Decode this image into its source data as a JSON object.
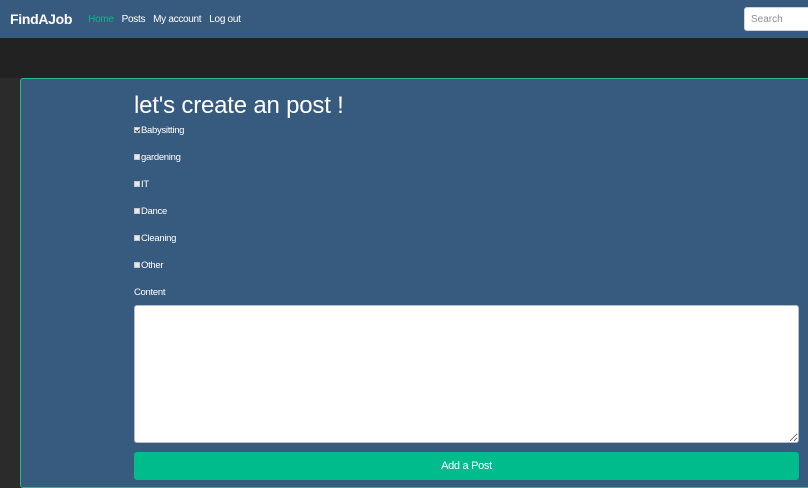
{
  "navbar": {
    "brand": "FindAJob",
    "links": [
      {
        "label": "Home",
        "active": true
      },
      {
        "label": "Posts",
        "active": false
      },
      {
        "label": "My account",
        "active": false
      },
      {
        "label": "Log out",
        "active": false
      }
    ],
    "search_placeholder": "Search"
  },
  "form": {
    "title": "let's create an post !",
    "categories": [
      {
        "label": "Babysitting",
        "checked": true
      },
      {
        "label": "gardening",
        "checked": false
      },
      {
        "label": "IT",
        "checked": false
      },
      {
        "label": "Dance",
        "checked": false
      },
      {
        "label": "Cleaning",
        "checked": false
      },
      {
        "label": "Other",
        "checked": false
      }
    ],
    "content_label": "Content",
    "content_value": "",
    "submit_label": "Add a Post"
  },
  "colors": {
    "navbar_bg": "#375a7f",
    "accent": "#00bc8c",
    "page_bg": "#2b2b2b",
    "band_bg": "#222222"
  }
}
